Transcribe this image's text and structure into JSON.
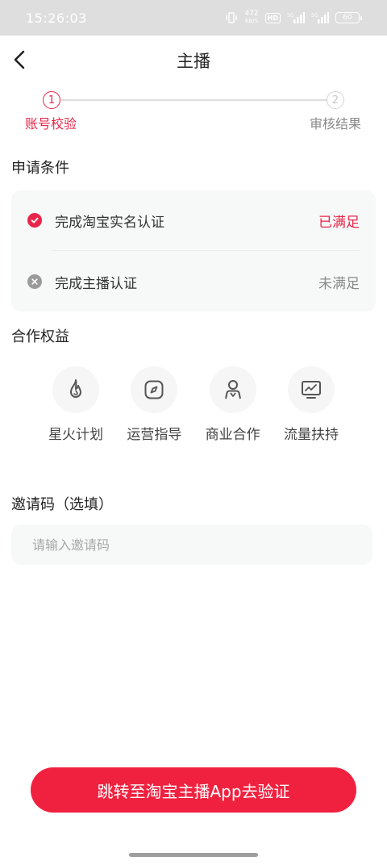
{
  "status_bar": {
    "time": "15:26:03",
    "net_speed_value": "472",
    "net_speed_unit": "KB/S",
    "hd_label": "HD",
    "battery": "60"
  },
  "nav": {
    "title": "主播",
    "back_icon": "chevron-left-icon"
  },
  "stepper": {
    "steps": [
      {
        "number": "1",
        "label": "账号校验",
        "state": "active"
      },
      {
        "number": "2",
        "label": "审核结果",
        "state": "inactive"
      }
    ],
    "active_color": "#e8264a"
  },
  "conditions": {
    "title": "申请条件",
    "items": [
      {
        "text": "完成淘宝实名认证",
        "status": "已满足",
        "met": true
      },
      {
        "text": "完成主播认证",
        "status": "未满足",
        "met": false
      }
    ]
  },
  "benefits": {
    "title": "合作权益",
    "items": [
      {
        "label": "星火计划",
        "icon": "flame-icon"
      },
      {
        "label": "运营指导",
        "icon": "compass-icon"
      },
      {
        "label": "商业合作",
        "icon": "business-person-icon"
      },
      {
        "label": "流量扶持",
        "icon": "trend-chart-icon"
      }
    ]
  },
  "invite": {
    "title": "邀请码（选填）",
    "placeholder": "请输入邀请码",
    "value": ""
  },
  "cta": {
    "label": "跳转至淘宝主播App去验证",
    "color": "#f0213f"
  }
}
